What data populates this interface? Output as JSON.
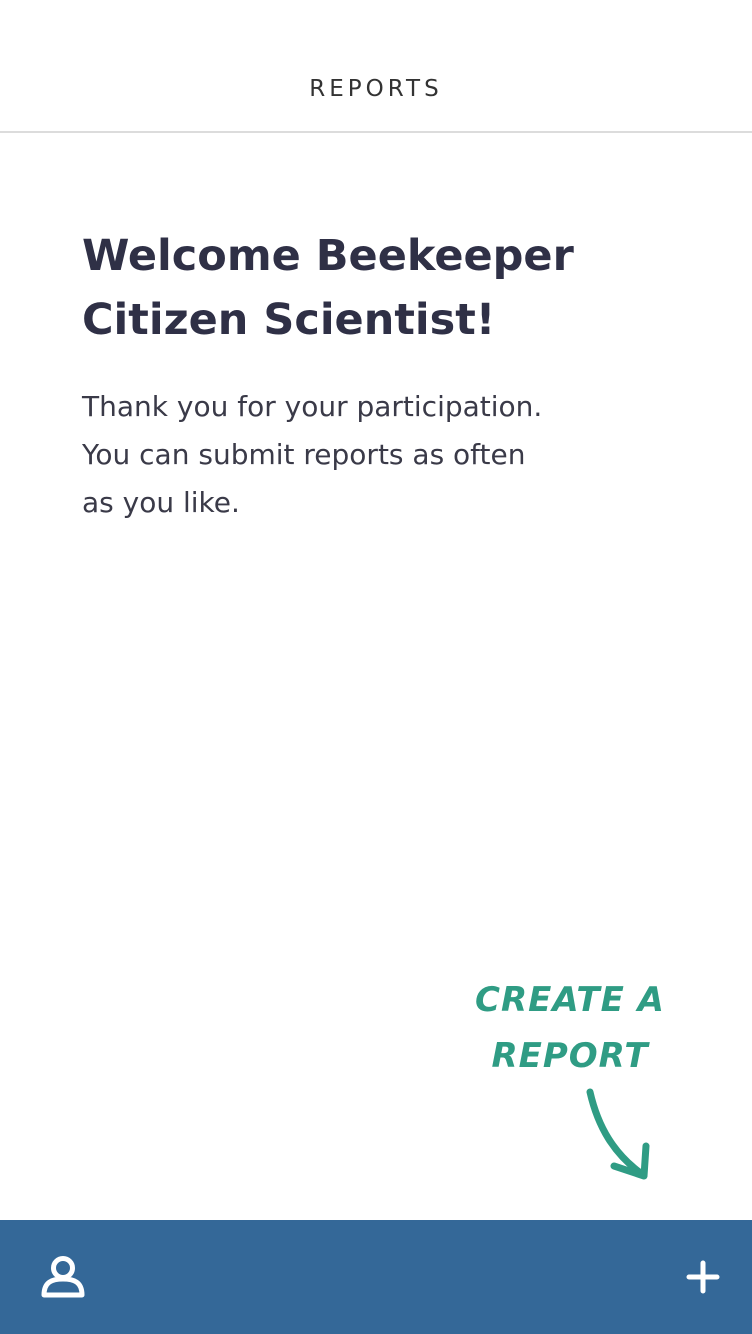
{
  "header": {
    "title": "REPORTS"
  },
  "welcome": {
    "title_line1": "Welcome Beekeeper",
    "title_line2": "Citizen Scientist!",
    "body_line1": "Thank you for your participation.",
    "body_line2": "You can submit reports as often",
    "body_line3": "as you like."
  },
  "annotation": {
    "line1": "CREATE A",
    "line2": "REPORT",
    "color": "#2f9c84"
  },
  "bottom_bar": {
    "background": "#346898",
    "left_icon": "user-icon",
    "right_icon": "plus-icon"
  }
}
